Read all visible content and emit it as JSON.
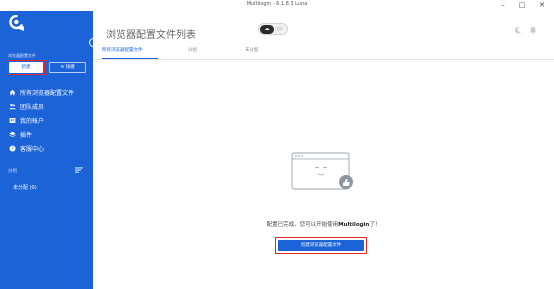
{
  "window": {
    "title": "Multilogin - 6.1.8.3 Luna",
    "minimize_glyph": "–",
    "maximize_glyph": "□",
    "close_glyph": "✕"
  },
  "sidebar": {
    "section_title": "浏览器配置文件",
    "new_button": "新建",
    "sync_button": "⟲ 快捷",
    "items": [
      {
        "label": "所有浏览器配置文件",
        "icon": "home-icon"
      },
      {
        "label": "团队成员",
        "icon": "team-icon"
      },
      {
        "label": "我的帐户",
        "icon": "account-card-icon"
      },
      {
        "label": "插件",
        "icon": "layers-icon"
      },
      {
        "label": "客服中心",
        "icon": "help-icon"
      }
    ],
    "groups_label": "分组",
    "group_item": "未分配 (0)",
    "collapse_glyph": "‹"
  },
  "header": {
    "title": "浏览器配置文件列表",
    "toggle_on_glyph": "☁",
    "toggle_off_glyph": "▭"
  },
  "tabs": [
    {
      "label": "所有浏览器配置文件",
      "active": true
    },
    {
      "label": "分组",
      "active": false
    },
    {
      "label": "未分配",
      "active": false
    }
  ],
  "empty_state": {
    "message_prefix": "配置已完成。您可以开始使用",
    "message_brand": "Multilogin",
    "message_suffix": "了！",
    "create_button": "创建浏览器配置文件"
  },
  "colors": {
    "brand": "#1b63d6",
    "highlight": "#e02a2a"
  }
}
